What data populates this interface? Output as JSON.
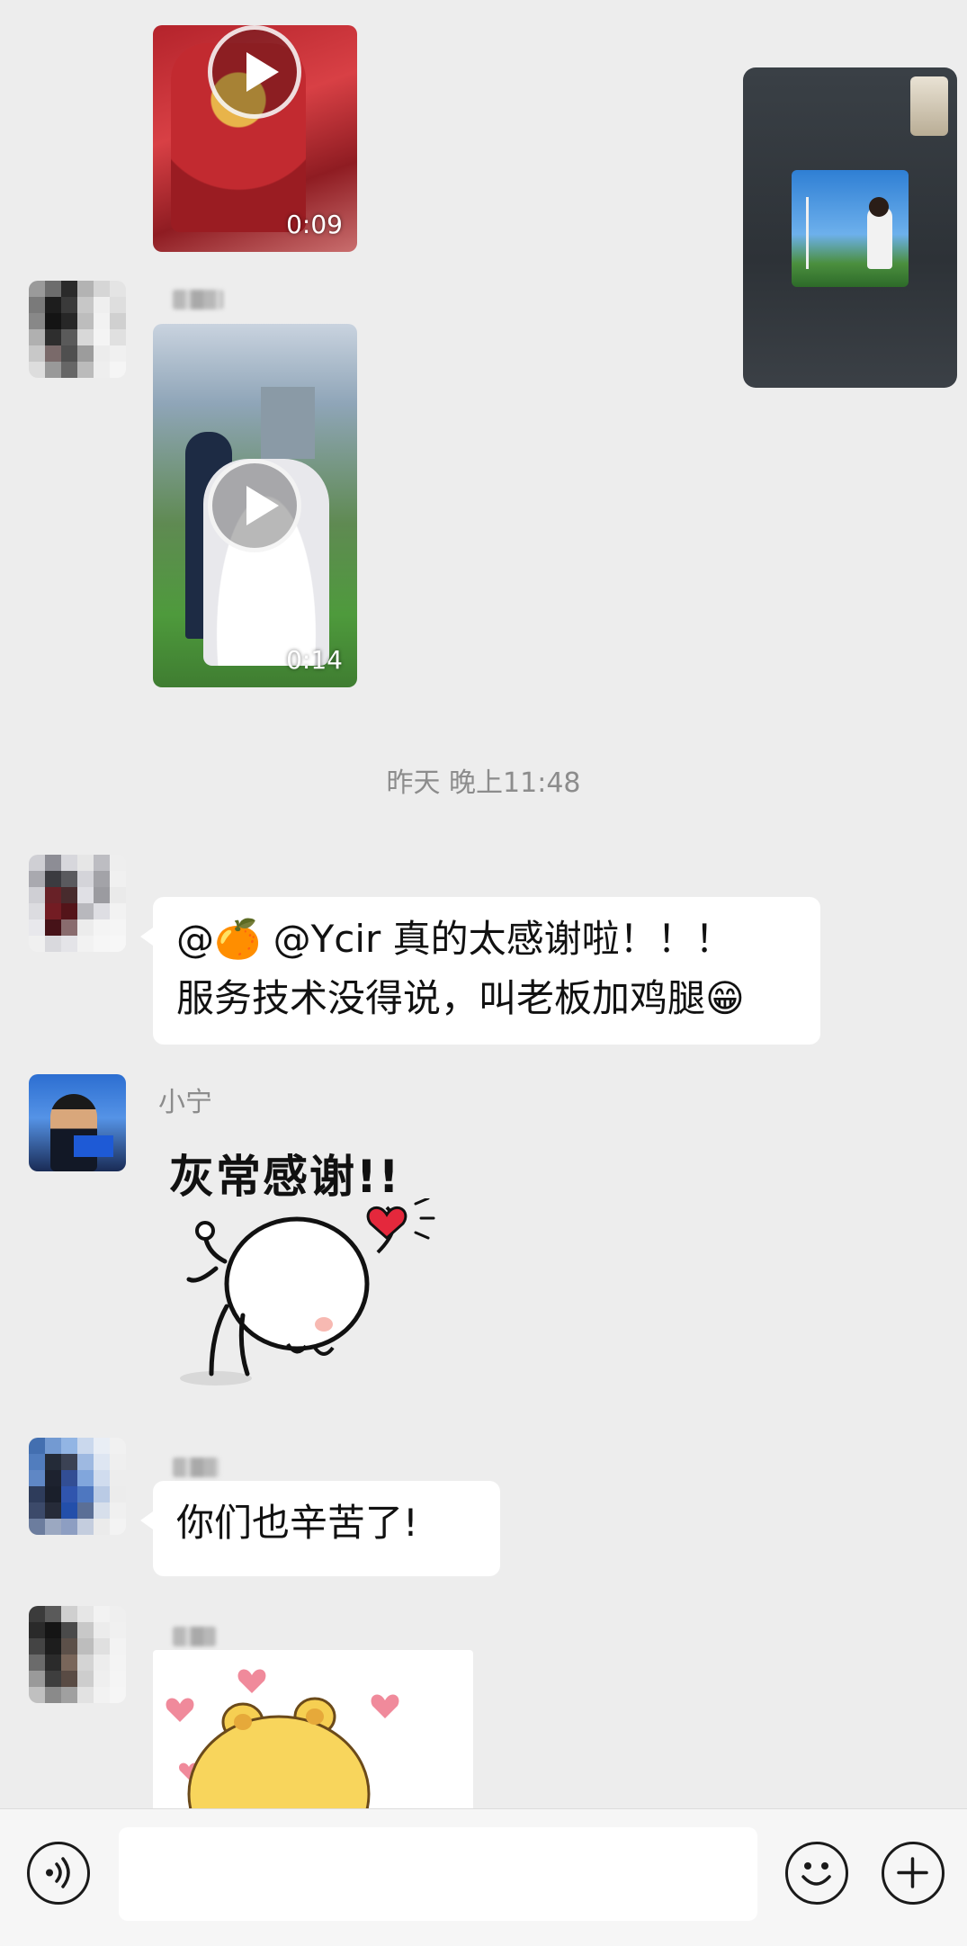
{
  "timestamp": "昨天 晚上11:48",
  "messages": [
    {
      "type": "video",
      "duration": "0:09"
    },
    {
      "type": "video_call_screenshot"
    },
    {
      "type": "video",
      "duration": "0:14"
    },
    {
      "type": "text",
      "sender": "",
      "line1": "@🍊 @Ycir  真的太感谢啦！！！",
      "line2": "服务技术没得说，叫老板加鸡腿😁"
    },
    {
      "type": "sticker",
      "sender": "小宁",
      "sticker_text": "灰常感谢!!"
    },
    {
      "type": "text",
      "sender": "",
      "line1": "你们也辛苦了!"
    },
    {
      "type": "sticker",
      "sender": "",
      "sticker_text": ""
    }
  ],
  "input": {
    "placeholder": ""
  },
  "icons": {
    "voice": "voice-icon",
    "emoji": "emoji-icon",
    "add": "add-icon"
  },
  "colors": {
    "background": "#ededed",
    "bubble": "#ffffff",
    "meta_text": "#8c8c8c"
  }
}
